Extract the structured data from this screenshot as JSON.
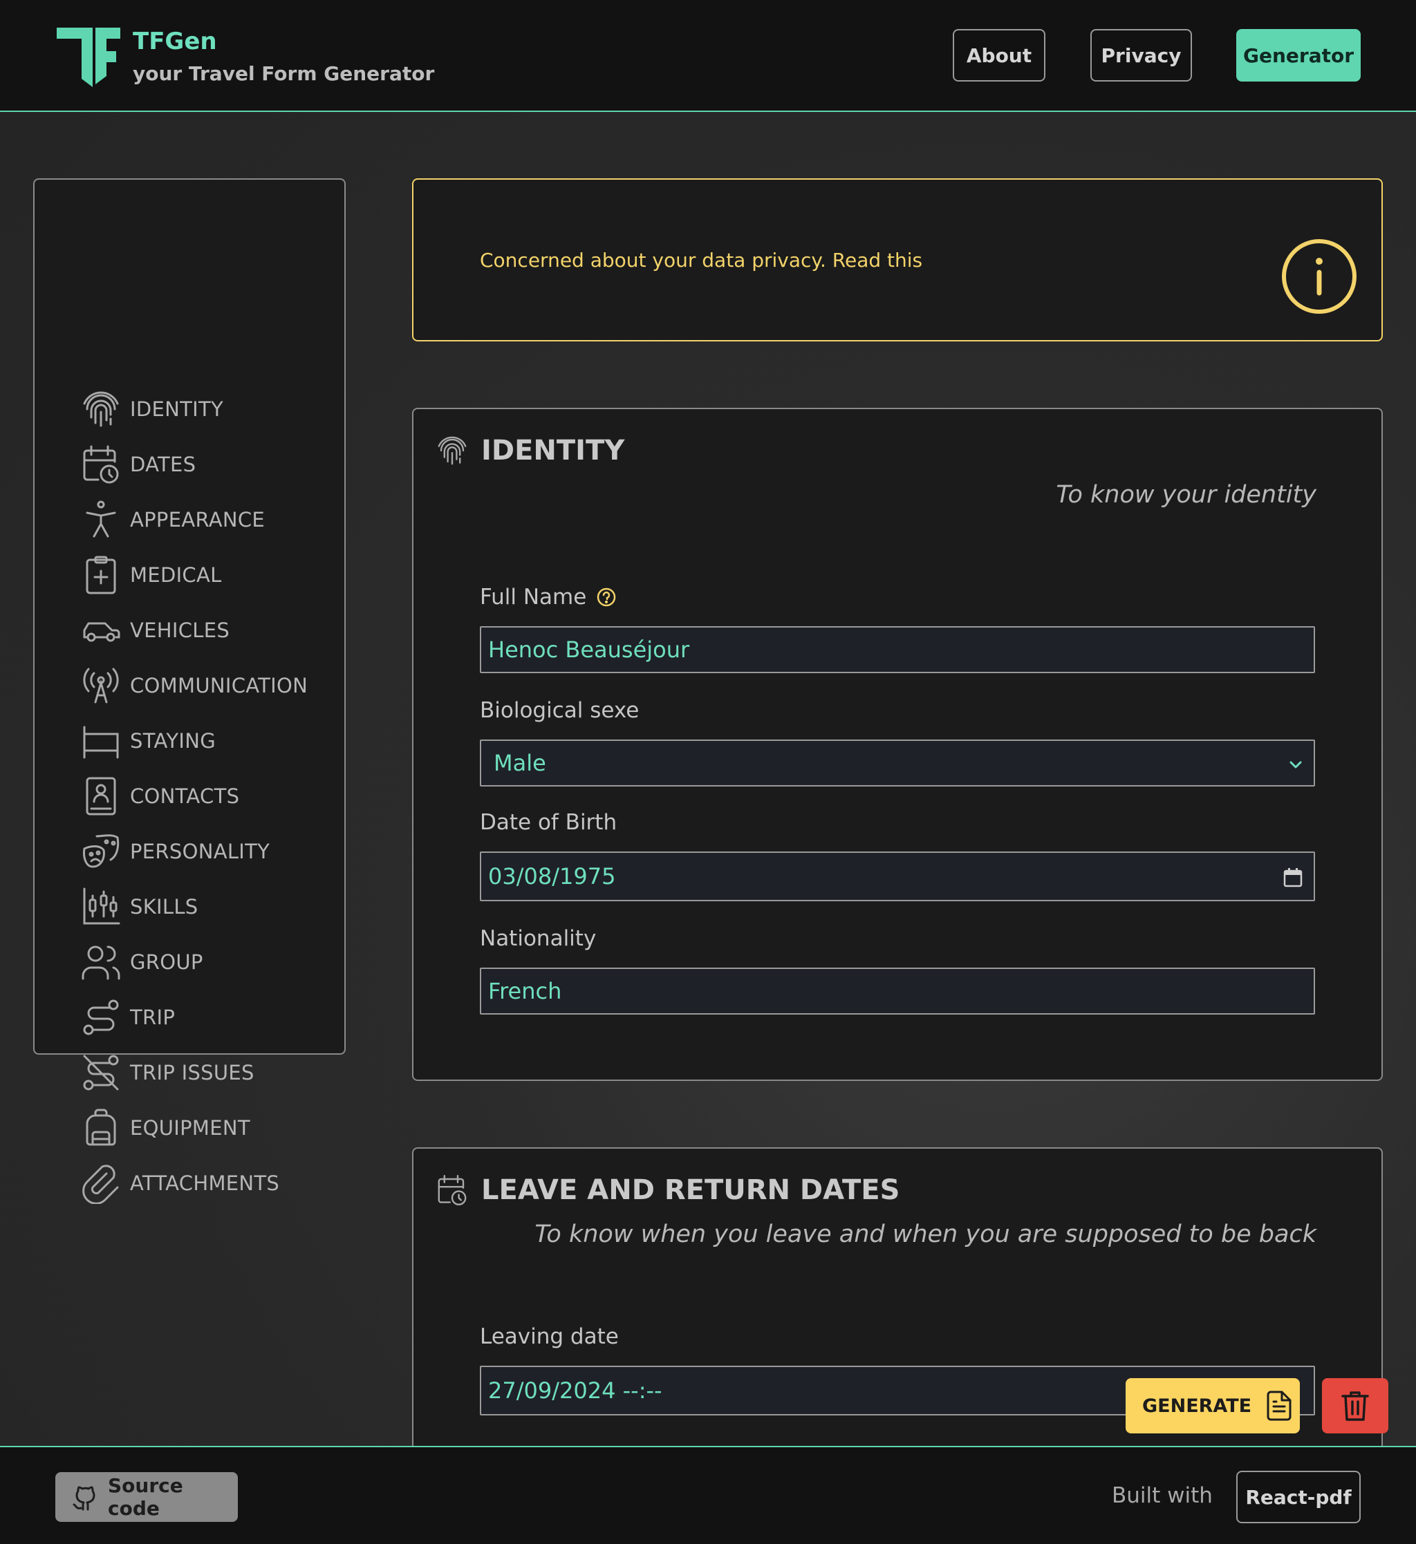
{
  "header": {
    "brand_name": "TFGen",
    "brand_tagline": "your Travel Form Generator",
    "nav": {
      "about": "About",
      "privacy": "Privacy",
      "generator": "Generator"
    }
  },
  "sidebar": {
    "items": [
      {
        "label": "IDENTITY",
        "icon": "fingerprint-icon"
      },
      {
        "label": "DATES",
        "icon": "calendar-clock-icon"
      },
      {
        "label": "APPEARANCE",
        "icon": "person-icon"
      },
      {
        "label": "MEDICAL",
        "icon": "medical-clipboard-icon"
      },
      {
        "label": "VEHICLES",
        "icon": "car-icon"
      },
      {
        "label": "COMMUNICATION",
        "icon": "antenna-icon"
      },
      {
        "label": "STAYING",
        "icon": "bed-icon"
      },
      {
        "label": "CONTACTS",
        "icon": "contact-book-icon"
      },
      {
        "label": "PERSONALITY",
        "icon": "masks-icon"
      },
      {
        "label": "SKILLS",
        "icon": "skills-chart-icon"
      },
      {
        "label": "GROUP",
        "icon": "users-icon"
      },
      {
        "label": "TRIP",
        "icon": "route-icon"
      },
      {
        "label": "TRIP ISSUES",
        "icon": "route-off-icon"
      },
      {
        "label": "EQUIPMENT",
        "icon": "backpack-icon"
      },
      {
        "label": "ATTACHMENTS",
        "icon": "paperclip-icon"
      }
    ]
  },
  "privacy_alert": {
    "text": "Concerned about your data privacy. Read this",
    "icon": "info-icon"
  },
  "identity": {
    "title": "IDENTITY",
    "subtitle": "To know your identity",
    "full_name": {
      "label": "Full Name",
      "value": "Henoc Beauséjour"
    },
    "sex": {
      "label": "Biological sexe",
      "value": "Male"
    },
    "dob": {
      "label": "Date of Birth",
      "value": "03/08/1975"
    },
    "nationality": {
      "label": "Nationality",
      "value": "French"
    }
  },
  "dates": {
    "title": "LEAVE AND RETURN DATES",
    "subtitle": "To know when you leave and when you are supposed to be back",
    "leaving": {
      "label": "Leaving date",
      "value": "27/09/2024  --:--"
    }
  },
  "actions": {
    "generate": "GENERATE"
  },
  "footer": {
    "source_code": "Source code",
    "built_with": "Built with",
    "react_pdf": "React-pdf"
  },
  "colors": {
    "accent": "#5fd6b0",
    "warning": "#f3d36a",
    "generate": "#fcd561",
    "danger": "#e5483e",
    "panel": "#1b1b1b"
  }
}
